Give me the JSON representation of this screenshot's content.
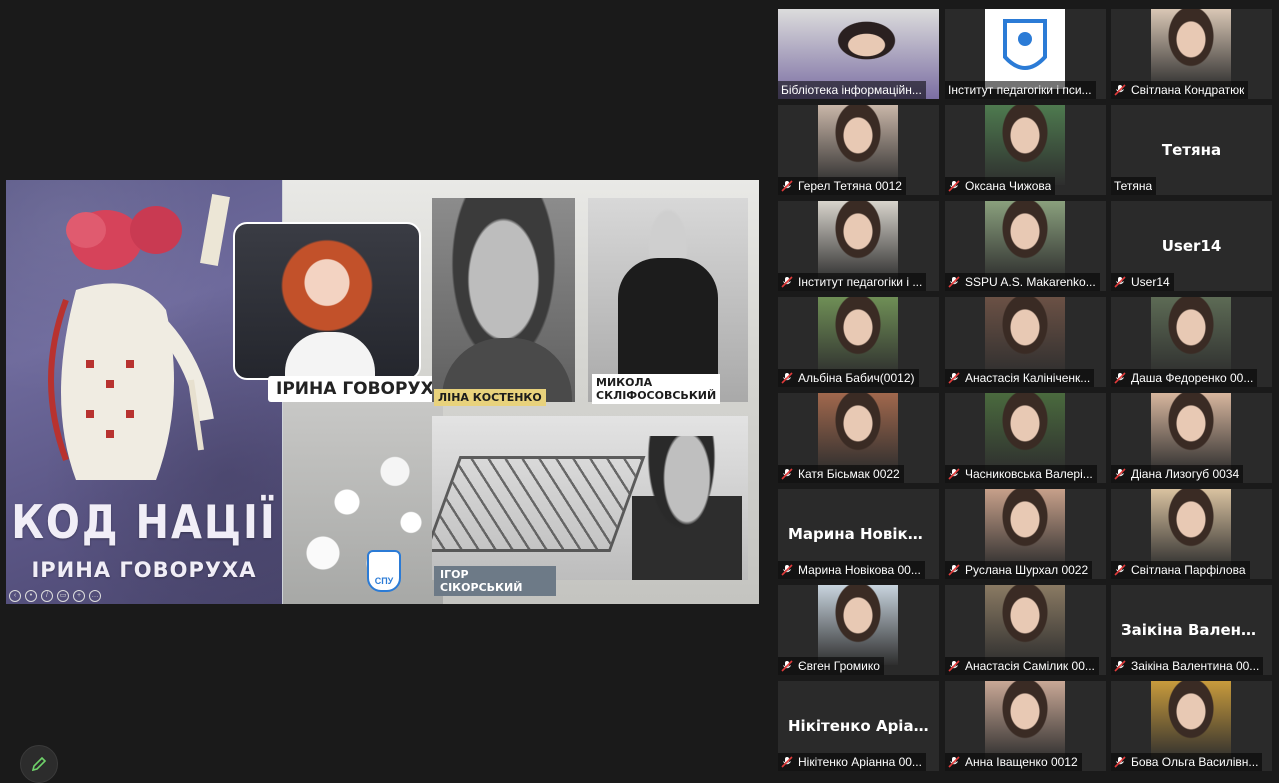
{
  "share": {
    "book_title": "КОД НАЦІЇ",
    "book_author": "ІРИНА ГОВОРУХА",
    "portrait_names": {
      "irina": "ІРИНА ГОВОРУХА",
      "kostenko": "ЛІНА КОСТЕНКО",
      "sklifosovsky_line1": "МИКОЛА",
      "sklifosovsky_line2": "СКЛІФОСОВСЬКИЙ",
      "sikorsky": "ІГОР СІКОРСЬКИЙ"
    },
    "logo_text": "СПУ"
  },
  "participants": [
    {
      "name": "Бібліотека інформаційн...",
      "active": true,
      "muted": false,
      "video": "#7b6ea3"
    },
    {
      "name": "Інститут педагогіки і пси...",
      "muted": false,
      "video": "#ffffff",
      "logo": true
    },
    {
      "name": "Світлана Кондратюк",
      "muted": true,
      "video": "#d9c7b5"
    },
    {
      "name": "Герел Тетяна  0012",
      "muted": true,
      "video": "#c9b6a8"
    },
    {
      "name": "Оксана Чижова",
      "muted": true,
      "video": "#4e7a4f"
    },
    {
      "name": "Тетяна",
      "big": "Тетяна",
      "muted": false
    },
    {
      "name": "Інститут педагогіки і ...",
      "muted": true,
      "video": "#d8d4cc"
    },
    {
      "name": "SSPU A.S. Makarenko...",
      "muted": true,
      "video": "#8aa07d"
    },
    {
      "name": "User14",
      "big": "User14",
      "muted": true
    },
    {
      "name": "Альбіна Бабич(0012)",
      "muted": true,
      "video": "#6f8f56"
    },
    {
      "name": "Анастасія Калініченк...",
      "muted": true,
      "video": "#6b5145"
    },
    {
      "name": "Даша Федоренко 00...",
      "muted": true,
      "video": "#5d6b55"
    },
    {
      "name": "Катя Бісьмак 0022",
      "muted": true,
      "video": "#a1684d"
    },
    {
      "name": "Часниковська Валері...",
      "muted": true,
      "video": "#4a6a3e"
    },
    {
      "name": "Діана Лизогуб 0034",
      "muted": true,
      "video": "#d7b69e"
    },
    {
      "name": "Марина Новікова 00...",
      "big": "Марина  Новіко...",
      "muted": true
    },
    {
      "name": "Руслана Шурхал 0022",
      "muted": true,
      "video": "#c7a08a"
    },
    {
      "name": "Світлана Парфілова",
      "muted": true,
      "video": "#d9c2a0"
    },
    {
      "name": "Євген Громико",
      "muted": true,
      "video": "#c8d4de"
    },
    {
      "name": "Анастасія Самілик 00...",
      "muted": true,
      "video": "#8a7a63"
    },
    {
      "name": "Заікіна Валентина 00...",
      "big": "Заікіна  Валенти...",
      "muted": true
    },
    {
      "name": "Нікітенко Аріанна 00...",
      "big": "Нікітенко  Аріан...",
      "muted": true
    },
    {
      "name": "Анна Іващенко 0012",
      "muted": true,
      "video": "#c9a896"
    },
    {
      "name": "Бова Ольга Василівн...",
      "muted": true,
      "video": "#c89b3c"
    }
  ]
}
